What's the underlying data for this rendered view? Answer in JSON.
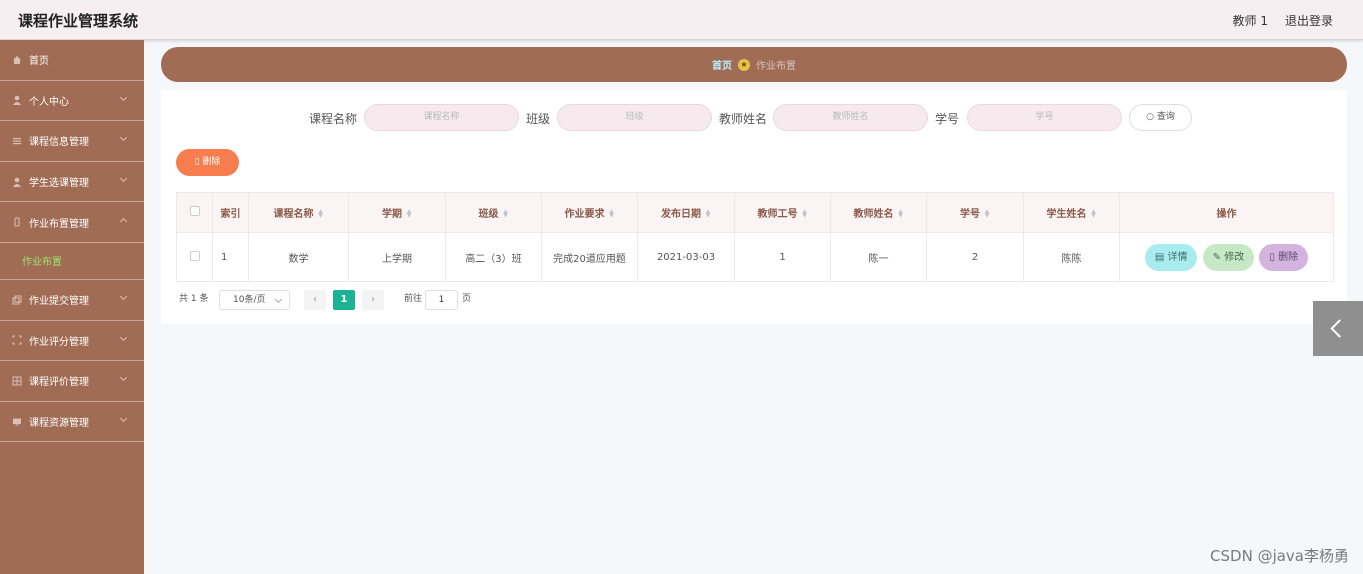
{
  "app": {
    "title": "课程作业管理系统",
    "user": "教师 1",
    "logout": "退出登录"
  },
  "sidebar": {
    "items": [
      {
        "label": "首页"
      },
      {
        "label": "个人中心"
      },
      {
        "label": "课程信息管理"
      },
      {
        "label": "学生选课管理"
      },
      {
        "label": "作业布置管理"
      },
      {
        "label": "作业提交管理"
      },
      {
        "label": "作业评分管理"
      },
      {
        "label": "课程评价管理"
      },
      {
        "label": "课程资源管理"
      }
    ],
    "active_sub": "作业布置"
  },
  "breadcrumb": {
    "home": "首页",
    "current": "作业布置"
  },
  "search": {
    "course_label": "课程名称",
    "course_placeholder": "课程名称",
    "class_label": "班级",
    "class_placeholder": "班级",
    "teacher_label": "教师姓名",
    "teacher_placeholder": "教师姓名",
    "student_label": "学号",
    "student_placeholder": "学号",
    "query_button": "查询"
  },
  "toolbar": {
    "delete_button": "删除"
  },
  "table": {
    "headers": [
      "索引",
      "课程名称",
      "学期",
      "班级",
      "作业要求",
      "发布日期",
      "教师工号",
      "教师姓名",
      "学号",
      "学生姓名",
      "操作"
    ],
    "rows": [
      {
        "index": "1",
        "course": "数学",
        "term": "上学期",
        "class": "高二（3）班",
        "requirement": "完成20道应用题",
        "date": "2021-03-03",
        "teacher_id": "1",
        "teacher_name": "陈一",
        "student_id": "2",
        "student_name": "陈陈"
      }
    ],
    "actions": {
      "detail": "详情",
      "edit": "修改",
      "delete": "删除"
    }
  },
  "pagination": {
    "total": "共 1 条",
    "page_size": "10条/页",
    "current_page": "1",
    "goto_label": "前往",
    "goto_value": "1",
    "page_suffix": "页"
  },
  "watermark": "CSDN @java李杨勇",
  "colors": {
    "sidebar": "#a16c54",
    "accent_green": "#1bb394",
    "delete_orange": "#f77d4e"
  }
}
